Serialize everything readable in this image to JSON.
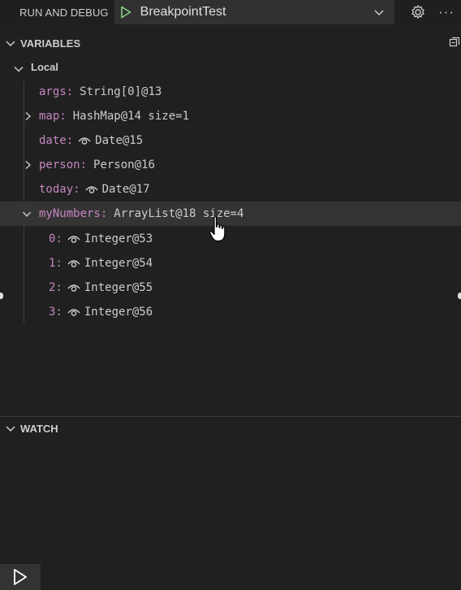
{
  "header": {
    "run_label": "RUN AND DEBUG",
    "config_name": "BreakpointTest",
    "more": "···"
  },
  "variables": {
    "title": "VARIABLES",
    "scope": "Local",
    "rows": [
      {
        "name": "args:",
        "value": "String[0]@13"
      },
      {
        "name": "map:",
        "value": "HashMap@14 size=1"
      },
      {
        "name": "date:",
        "value": "Date@15"
      },
      {
        "name": "person:",
        "value": "Person@16"
      },
      {
        "name": "today:",
        "value": "Date@17"
      },
      {
        "name": "myNumbers:",
        "value": "ArrayList@18 size=4"
      }
    ],
    "children": [
      {
        "name": "0:",
        "value": "Integer@53"
      },
      {
        "name": "1:",
        "value": "Integer@54"
      },
      {
        "name": "2:",
        "value": "Integer@55"
      },
      {
        "name": "3:",
        "value": "Integer@56"
      }
    ]
  },
  "watch": {
    "title": "WATCH"
  },
  "colors": {
    "name": "#c586c0",
    "play": "#89d185"
  }
}
